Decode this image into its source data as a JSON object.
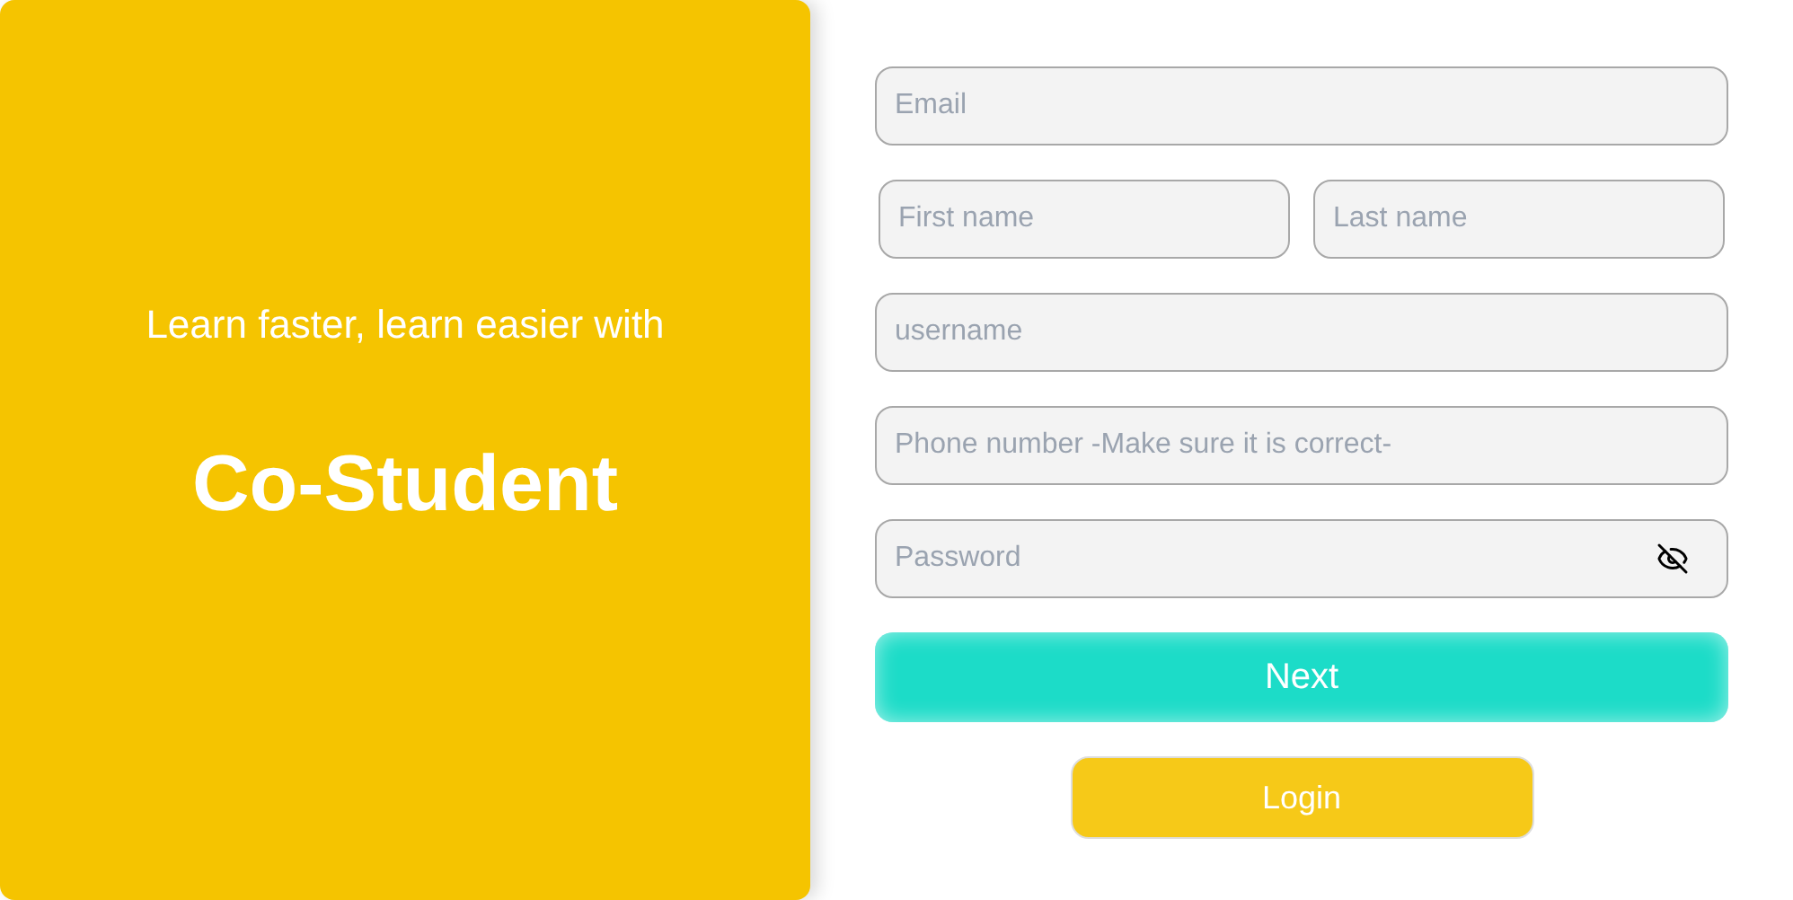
{
  "hero": {
    "tagline": "Learn faster, learn easier with",
    "brand": "Co-Student"
  },
  "fields": [
    {
      "kind": "text",
      "placeholder": "Email"
    },
    {
      "kind": "pair",
      "items": [
        {
          "placeholder": "First name"
        },
        {
          "placeholder": "Last name"
        }
      ]
    },
    {
      "kind": "text",
      "placeholder": "username"
    },
    {
      "kind": "text",
      "placeholder": "Phone number -Make sure it is correct-"
    },
    {
      "kind": "password",
      "placeholder": "Password"
    }
  ],
  "buttons": {
    "next": "Next",
    "login": "Login"
  }
}
